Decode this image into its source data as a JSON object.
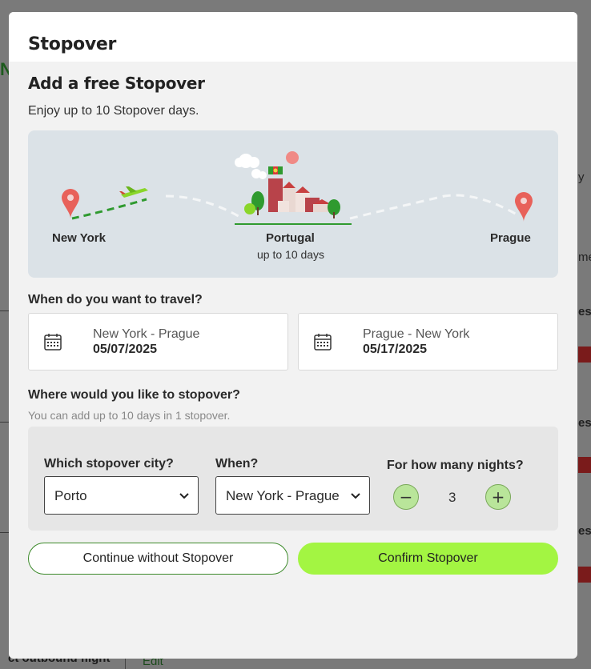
{
  "background": {
    "bottom_text": "ct outbound flight",
    "bottom_edit": "Edit"
  },
  "modal": {
    "title": "Stopover",
    "heading": "Add a free Stopover",
    "subtitle": "Enjoy up to 10 Stopover days.",
    "illustration": {
      "origin": "New York",
      "stopover": "Portugal",
      "stopover_sub": "up to 10 days",
      "destination": "Prague"
    },
    "travel_question": "When do you want to travel?",
    "outbound": {
      "route": "New York - Prague",
      "date": "05/07/2025"
    },
    "inbound": {
      "route": "Prague - New York",
      "date": "05/17/2025"
    },
    "stopover_question": "Where would you like to stopover?",
    "stopover_hint": "You can add up to 10 days in 1 stopover.",
    "city_label": "Which stopover city?",
    "city_value": "Porto",
    "when_label": "When?",
    "when_value": "New York - Prague",
    "nights_label": "For how many nights?",
    "nights_value": "3",
    "decrement_symbol": "−",
    "increment_symbol": "+",
    "continue_label": "Continue without Stopover",
    "confirm_label": "Confirm Stopover"
  },
  "colors": {
    "accent_green": "#a3f542",
    "pin_red": "#e8615a",
    "panel_blue": "#dbe2e7"
  }
}
